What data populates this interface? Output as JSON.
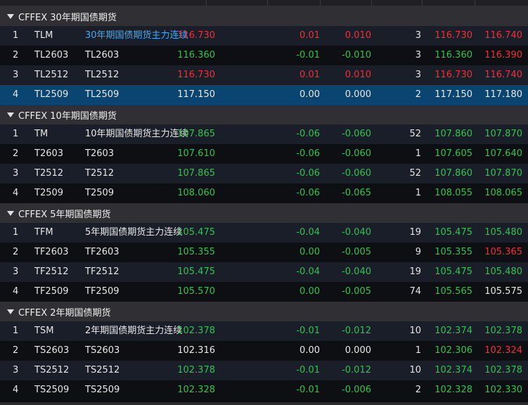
{
  "colors": {
    "up": "#f0303a",
    "down": "#34c253",
    "flat": "#e8e8e8",
    "link": "#4aa8f0",
    "selected": "#0a4470"
  },
  "groups": [
    {
      "title": "CFFEX 30年期国债期货",
      "rows": [
        {
          "idx": "1",
          "code": "TLM",
          "name": "30年期国债期货主力连续",
          "last": "116.730",
          "chg": "0.01",
          "chgp": "0.010",
          "vol": "3",
          "bid": "116.730",
          "ask": "116.740",
          "name_c": "link",
          "last_c": "up",
          "chg_c": "up",
          "chgp_c": "up",
          "bid_c": "up",
          "ask_c": "up"
        },
        {
          "idx": "2",
          "code": "TL2603",
          "name": "TL2603",
          "last": "116.360",
          "chg": "-0.01",
          "chgp": "-0.010",
          "vol": "3",
          "bid": "116.360",
          "ask": "116.390",
          "name_c": "flat",
          "last_c": "down",
          "chg_c": "down",
          "chgp_c": "down",
          "bid_c": "down",
          "ask_c": "up"
        },
        {
          "idx": "3",
          "code": "TL2512",
          "name": "TL2512",
          "last": "116.730",
          "chg": "0.01",
          "chgp": "0.010",
          "vol": "3",
          "bid": "116.730",
          "ask": "116.740",
          "name_c": "flat",
          "last_c": "up",
          "chg_c": "up",
          "chgp_c": "up",
          "bid_c": "up",
          "ask_c": "up"
        },
        {
          "idx": "4",
          "code": "TL2509",
          "name": "TL2509",
          "last": "117.150",
          "chg": "0.00",
          "chgp": "0.000",
          "vol": "2",
          "bid": "117.150",
          "ask": "117.180",
          "name_c": "flat",
          "last_c": "flat",
          "chg_c": "flat",
          "chgp_c": "flat",
          "bid_c": "flat",
          "ask_c": "flat",
          "selected": true
        }
      ]
    },
    {
      "title": "CFFEX 10年期国债期货",
      "rows": [
        {
          "idx": "1",
          "code": "TM",
          "name": "10年期国债期货主力连续",
          "last": "107.865",
          "chg": "-0.06",
          "chgp": "-0.060",
          "vol": "52",
          "bid": "107.860",
          "ask": "107.870",
          "name_c": "flat",
          "last_c": "down",
          "chg_c": "down",
          "chgp_c": "down",
          "bid_c": "down",
          "ask_c": "down"
        },
        {
          "idx": "2",
          "code": "T2603",
          "name": "T2603",
          "last": "107.610",
          "chg": "-0.06",
          "chgp": "-0.060",
          "vol": "1",
          "bid": "107.605",
          "ask": "107.640",
          "name_c": "flat",
          "last_c": "down",
          "chg_c": "down",
          "chgp_c": "down",
          "bid_c": "down",
          "ask_c": "down"
        },
        {
          "idx": "3",
          "code": "T2512",
          "name": "T2512",
          "last": "107.865",
          "chg": "-0.06",
          "chgp": "-0.060",
          "vol": "52",
          "bid": "107.860",
          "ask": "107.870",
          "name_c": "flat",
          "last_c": "down",
          "chg_c": "down",
          "chgp_c": "down",
          "bid_c": "down",
          "ask_c": "down"
        },
        {
          "idx": "4",
          "code": "T2509",
          "name": "T2509",
          "last": "108.060",
          "chg": "-0.06",
          "chgp": "-0.065",
          "vol": "1",
          "bid": "108.055",
          "ask": "108.065",
          "name_c": "flat",
          "last_c": "down",
          "chg_c": "down",
          "chgp_c": "down",
          "bid_c": "down",
          "ask_c": "down"
        }
      ]
    },
    {
      "title": "CFFEX 5年期国债期货",
      "rows": [
        {
          "idx": "1",
          "code": "TFM",
          "name": "5年期国债期货主力连续",
          "last": "105.475",
          "chg": "-0.04",
          "chgp": "-0.040",
          "vol": "19",
          "bid": "105.475",
          "ask": "105.480",
          "name_c": "flat",
          "last_c": "down",
          "chg_c": "down",
          "chgp_c": "down",
          "bid_c": "down",
          "ask_c": "down"
        },
        {
          "idx": "2",
          "code": "TF2603",
          "name": "TF2603",
          "last": "105.355",
          "chg": "0.00",
          "chgp": "-0.005",
          "vol": "9",
          "bid": "105.355",
          "ask": "105.365",
          "name_c": "flat",
          "last_c": "down",
          "chg_c": "down",
          "chgp_c": "down",
          "bid_c": "down",
          "ask_c": "up"
        },
        {
          "idx": "3",
          "code": "TF2512",
          "name": "TF2512",
          "last": "105.475",
          "chg": "-0.04",
          "chgp": "-0.040",
          "vol": "19",
          "bid": "105.475",
          "ask": "105.480",
          "name_c": "flat",
          "last_c": "down",
          "chg_c": "down",
          "chgp_c": "down",
          "bid_c": "down",
          "ask_c": "down"
        },
        {
          "idx": "4",
          "code": "TF2509",
          "name": "TF2509",
          "last": "105.570",
          "chg": "0.00",
          "chgp": "-0.005",
          "vol": "74",
          "bid": "105.565",
          "ask": "105.575",
          "name_c": "flat",
          "last_c": "down",
          "chg_c": "down",
          "chgp_c": "down",
          "bid_c": "down",
          "ask_c": "flat"
        }
      ]
    },
    {
      "title": "CFFEX 2年期国债期货",
      "rows": [
        {
          "idx": "1",
          "code": "TSM",
          "name": "2年期国债期货主力连续",
          "last": "102.378",
          "chg": "-0.01",
          "chgp": "-0.012",
          "vol": "10",
          "bid": "102.374",
          "ask": "102.378",
          "name_c": "flat",
          "last_c": "down",
          "chg_c": "down",
          "chgp_c": "down",
          "bid_c": "down",
          "ask_c": "down"
        },
        {
          "idx": "2",
          "code": "TS2603",
          "name": "TS2603",
          "last": "102.316",
          "chg": "0.00",
          "chgp": "0.000",
          "vol": "1",
          "bid": "102.306",
          "ask": "102.324",
          "name_c": "flat",
          "last_c": "flat",
          "chg_c": "flat",
          "chgp_c": "flat",
          "bid_c": "down",
          "ask_c": "up"
        },
        {
          "idx": "3",
          "code": "TS2512",
          "name": "TS2512",
          "last": "102.378",
          "chg": "-0.01",
          "chgp": "-0.012",
          "vol": "10",
          "bid": "102.374",
          "ask": "102.378",
          "name_c": "flat",
          "last_c": "down",
          "chg_c": "down",
          "chgp_c": "down",
          "bid_c": "down",
          "ask_c": "down"
        },
        {
          "idx": "4",
          "code": "TS2509",
          "name": "TS2509",
          "last": "102.328",
          "chg": "-0.01",
          "chgp": "-0.006",
          "vol": "2",
          "bid": "102.328",
          "ask": "102.330",
          "name_c": "flat",
          "last_c": "down",
          "chg_c": "down",
          "chgp_c": "down",
          "bid_c": "down",
          "ask_c": "down"
        }
      ]
    }
  ]
}
